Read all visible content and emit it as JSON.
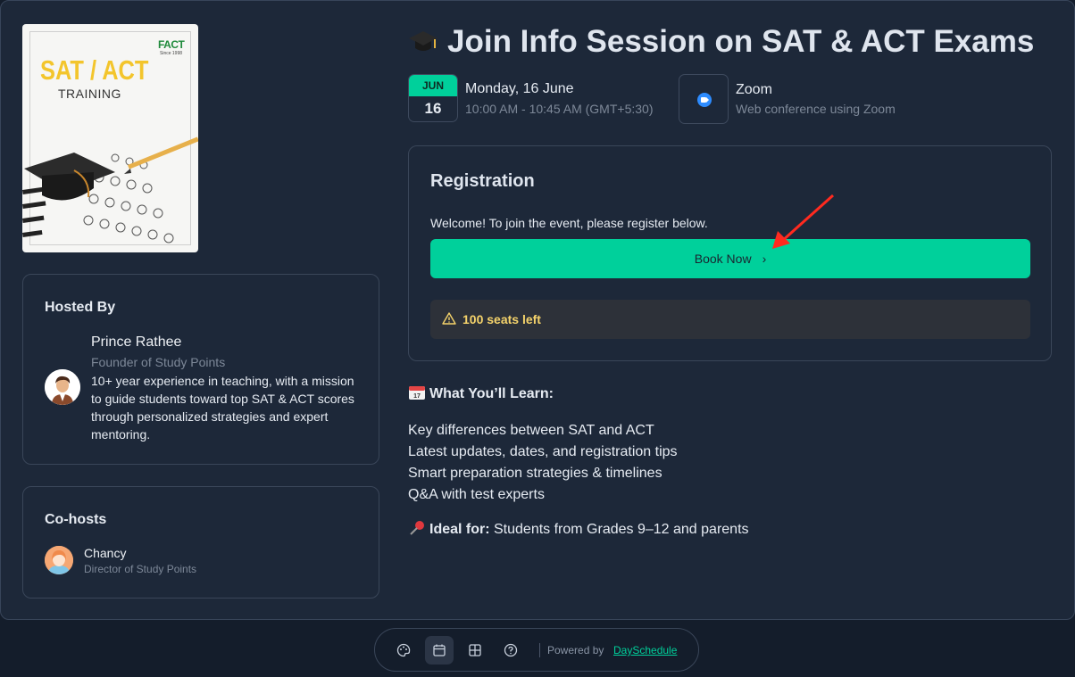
{
  "cover": {
    "title": "SAT / ACT",
    "subtitle": "TRAINING",
    "logo": "FACT",
    "logo_sub": "Since 1998"
  },
  "host": {
    "heading": "Hosted By",
    "name": "Prince Rathee",
    "role": "Founder of Study Points",
    "bio": "10+ year experience in teaching, with a mission to guide students toward top SAT & ACT scores through personalized strategies and expert mentoring."
  },
  "cohost": {
    "heading": "Co-hosts",
    "name": "Chancy",
    "role": "Director of Study Points"
  },
  "event": {
    "title": "Join Info Session on SAT & ACT Exams",
    "month": "JUN",
    "day": "16",
    "date_text": "Monday, 16 June",
    "time_text": "10:00 AM - 10:45 AM (GMT+5:30)",
    "location": "Zoom",
    "location_sub": "Web conference using Zoom"
  },
  "registration": {
    "heading": "Registration",
    "welcome": "Welcome! To join the event, please register below.",
    "button": "Book Now",
    "seats": "100 seats left"
  },
  "learn": {
    "heading": "What You’ll Learn:",
    "items": [
      "Key differences between SAT and ACT",
      "Latest updates, dates, and registration tips",
      "Smart preparation strategies & timelines",
      "Q&A with test experts"
    ],
    "ideal_label": "Ideal for:",
    "ideal_text": " Students from Grades 9–12 and parents"
  },
  "footer": {
    "powered": "Powered by",
    "brand": "DaySchedule"
  },
  "colors": {
    "accent": "#00d09b",
    "background": "#141d2b",
    "card": "#1d2839",
    "warning": "#f5d36b"
  },
  "icons": [
    "graduation-cap-icon",
    "zoom-icon",
    "calendar-emoji-icon",
    "pushpin-icon",
    "warning-icon",
    "palette-icon",
    "calendar-icon",
    "grid-icon",
    "help-icon",
    "chevron-right-icon"
  ]
}
